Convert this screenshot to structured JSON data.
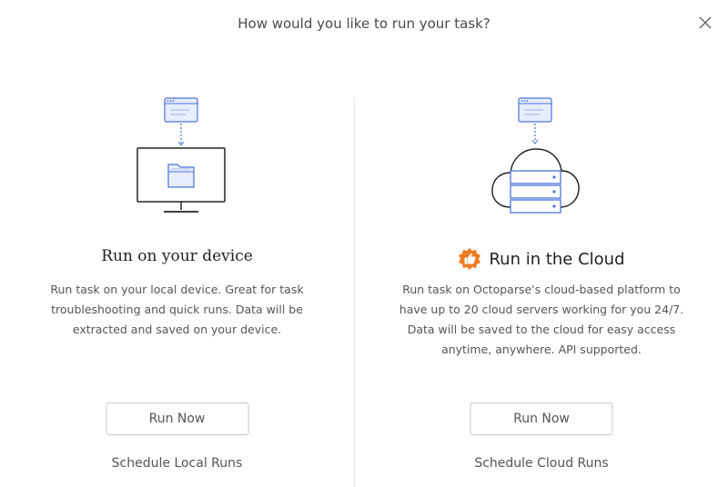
{
  "dialog": {
    "title": "How would you like to run your task?",
    "close_icon": "close-icon"
  },
  "local": {
    "title": "Run on your device",
    "description": "Run task on your local device. Great for task troubleshooting and quick runs. Data will be extracted and saved on your device.",
    "run_button": "Run Now",
    "schedule_link": "Schedule Local Runs",
    "illustration_icon": "monitor-folder-icon"
  },
  "cloud": {
    "title": "Run in the Cloud",
    "description": "Run task on Octoparse's cloud-based platform to have up to 20 cloud servers working for you 24/7. Data will be saved to the cloud for easy access anytime, anywhere. API supported.",
    "run_button": "Run Now",
    "schedule_link": "Schedule Cloud Runs",
    "badge_icon": "thumbs-up-badge-icon",
    "illustration_icon": "cloud-server-icon"
  },
  "colors": {
    "accent_blue": "#4a73d9",
    "light_blue_fill": "#e6eeff",
    "badge_orange": "#f07a24",
    "divider": "#e6e6e6"
  }
}
